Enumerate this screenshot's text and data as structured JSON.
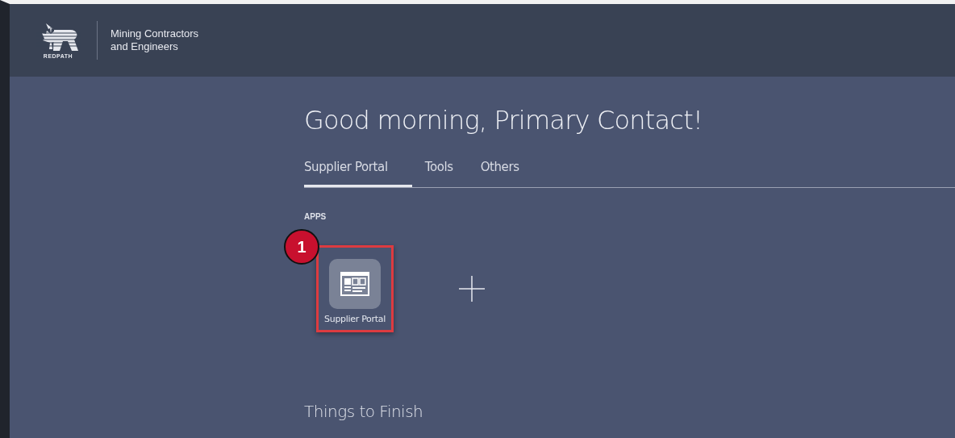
{
  "header": {
    "logo_text": "REDPATH",
    "company": "Mining Contractors",
    "company_line2": "and Engineers"
  },
  "greeting": "Good morning, Primary Contact!",
  "tabs": [
    {
      "label": "Supplier Portal",
      "selected": true
    },
    {
      "label": "Tools",
      "selected": false
    },
    {
      "label": "Others",
      "selected": false
    }
  ],
  "apps_heading": "APPS",
  "apps": [
    {
      "label": "Supplier Portal",
      "highlighted": true,
      "callout": "1"
    }
  ],
  "next_section": "Things to Finish"
}
